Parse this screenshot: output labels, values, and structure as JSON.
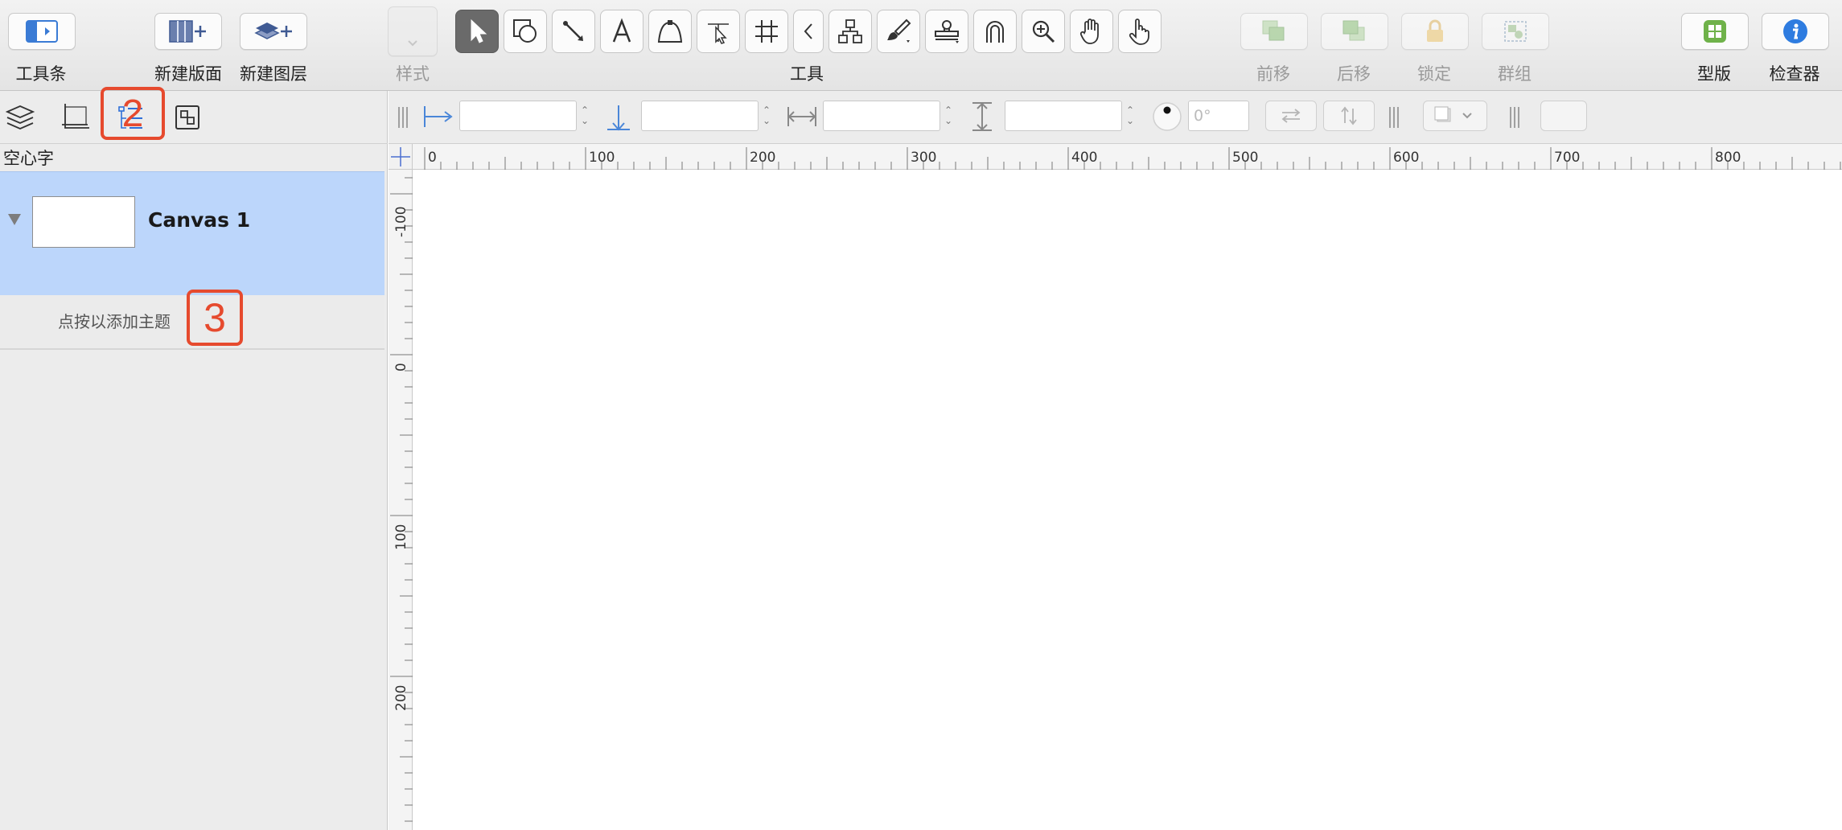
{
  "toolbar": {
    "items": [
      {
        "id": "toolbar-toggle",
        "label": "工具条",
        "icon": "sidebar-toggle-icon"
      },
      {
        "id": "new-canvas",
        "label": "新建版面",
        "icon": "new-canvas-icon"
      },
      {
        "id": "new-layer",
        "label": "新建图层",
        "icon": "new-layer-icon"
      },
      {
        "id": "style",
        "label": "样式",
        "icon": "style-well-icon"
      },
      {
        "id": "bring-forward",
        "label": "前移",
        "icon": "bring-forward-icon"
      },
      {
        "id": "send-backward",
        "label": "后移",
        "icon": "send-backward-icon"
      },
      {
        "id": "lock",
        "label": "锁定",
        "icon": "lock-icon"
      },
      {
        "id": "group",
        "label": "群组",
        "icon": "group-icon"
      },
      {
        "id": "stencils",
        "label": "型版",
        "icon": "stencils-icon"
      },
      {
        "id": "inspector",
        "label": "检查器",
        "icon": "info-icon"
      }
    ],
    "tools_label": "工具",
    "tools": [
      "selection-arrow-icon",
      "shape-icon",
      "line-icon",
      "text-icon",
      "pen-icon",
      "point-editor-icon",
      "diagram-grid-icon",
      "collapse-chevron-icon",
      "hierarchy-icon",
      "style-brush-icon",
      "rubber-stamp-icon",
      "magnet-icon",
      "zoom-icon",
      "hand-icon",
      "browse-hand-icon"
    ]
  },
  "sidebar": {
    "tabs": [
      "layers-icon",
      "canvas-outline-icon",
      "outline-icon",
      "selection-icon"
    ],
    "callout_tab": "2",
    "section_title": "空心字",
    "canvas_item": {
      "name": "Canvas 1"
    },
    "subject_placeholder": "点按以添加主题",
    "callout_subject": "3"
  },
  "inspector_bar": {
    "angle_placeholder": "0°"
  },
  "rulers": {
    "horizontal": [
      "0",
      "100",
      "200",
      "300",
      "400",
      "500",
      "600",
      "700",
      "800"
    ],
    "vertical": [
      "-100",
      "0",
      "100",
      "200"
    ]
  }
}
